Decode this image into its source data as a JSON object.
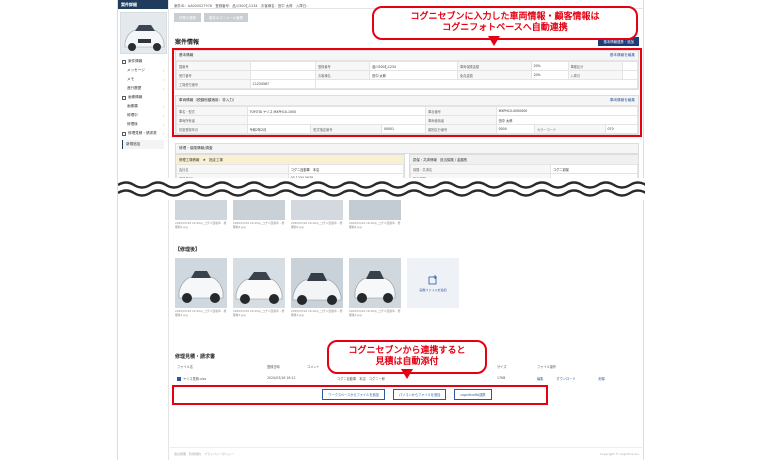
{
  "sidebar": {
    "header": "案件詳細",
    "items": [
      {
        "label": "案件情報",
        "level": 0
      },
      {
        "label": "メッセージ",
        "level": 1
      },
      {
        "label": "メモ",
        "level": 1
      },
      {
        "label": "進行履歴",
        "level": 1
      },
      {
        "label": "画像情報",
        "level": 0
      },
      {
        "label": "画像類",
        "level": 1
      },
      {
        "label": "修理中",
        "level": 1
      },
      {
        "label": "修理後",
        "level": 1
      },
      {
        "label": "修理見積・請求書",
        "level": 0
      }
    ],
    "active_item": "新規追加"
  },
  "topbar": {
    "text": "案件ID：AA000027978　登録番号：品川300む1234　お客様名：田中 太郎　入庫日："
  },
  "buttons": {
    "btn1": "作業の登録",
    "btn2": "基本のコニメール管理",
    "blue": "基本情報連携・追加"
  },
  "case_info": {
    "title": "案件情報",
    "basic": {
      "header": "基本情報",
      "link": "基本情報を編集",
      "rows": [
        [
          "国番号",
          "",
          "登録番号",
          "品川300む1234",
          "車両保険金額",
          "20%",
          "車種区分",
          ""
        ],
        [
          "受付番号",
          "",
          "お客様名",
          "田中 太郎",
          "免責金額",
          "20%",
          "入庫日",
          ""
        ],
        [
          "工場受付番号",
          "C1234567",
          "",
          "",
          "",
          "",
          "",
          ""
        ]
      ]
    },
    "vehicle": {
      "header": "車両情報（税額他額適用：非入力）",
      "link": "車両情報を編集",
      "rows": [
        [
          "車名・型式",
          "TOYOTA ヤリス MXPH10-1000",
          "",
          "",
          "",
          "車台番号",
          "MXPH10-0000000",
          "",
          ""
        ],
        [
          "車両所有者",
          "",
          "",
          "",
          "",
          "車両使用者",
          "田中 太郎",
          "",
          ""
        ],
        [
          "初度登録年月",
          "令和2年2月",
          "型式指定番号",
          "00001",
          "",
          "類別区分番号",
          "0000",
          "カラーコード",
          "070"
        ]
      ]
    }
  },
  "repair_info": {
    "title": "修理・保険情報/調査",
    "left_head": "修理工場情報　★　指定工場",
    "left_rows": [
      [
        "会社名",
        "コグニ自動車　本店"
      ],
      [
        "連絡先TEL",
        "03-1234-5678"
      ],
      [
        "連絡先TEL（FAX）",
        ""
      ]
    ],
    "right_head": "損保・共済情報　該当保険 / 金額別",
    "right_rows": [
      [
        "保険・共済名",
        "コグニ損保"
      ],
      [
        "担当部署",
        ""
      ],
      [
        "連絡先TEL/FAX番号",
        "/"
      ]
    ]
  },
  "photos_before": {
    "captions": [
      "2020/03/16 16:10ip_コグニ自動車 - 修理前1.jpg",
      "2020/03/16 16:10ip_コグニ自動車 - 修理前2.jpg",
      "2020/03/16 16:10ip_コグニ自動車 - 修理前3.jpg",
      "2020/03/16 16:10ip_コグニ自動車 - 修理前4.jpg"
    ]
  },
  "photos_after": {
    "title": "【修理後】",
    "captions": [
      "2020/03/16 16:10ip_コグニ自動車 - 修理後1.jpg",
      "2020/03/16 16:10ip_コグニ自動車 - 修理後2.jpg",
      "2020/03/16 16:10ip_コグニ自動車 - 修理後3.jpg",
      "2020/03/16 16:10ip_コグニ自動車 - 修理後4.jpg"
    ],
    "upload_label": "画像ファイルを追加"
  },
  "estimate": {
    "title": "修理見積・請求書",
    "columns": [
      "ファイル名",
      "登録日時",
      "コメント",
      "作成者",
      "サイズ",
      "ファイル操作"
    ],
    "row": {
      "file": "ヤリス見積.xlsx",
      "date": "2020/03/16 16:12",
      "author": "コグニ自動車　本店　コグニ一郎",
      "size": "17KB",
      "edit": "編集",
      "download": "ダウンロード",
      "delete": "削除"
    },
    "actions": [
      "ワークスペースからファイルを追加",
      "パソコンからファイルを追加",
      "cognitiveRA連携"
    ]
  },
  "callouts": {
    "top": "コグニセブンに入力した車両情報・顧客情報は\nコグニフォトベースへ自動連携",
    "bottom": "コグニセブンから連携すると\n見積は自動添付"
  },
  "footer": {
    "left": "会社概要　利用規約　プライバシーポリシー",
    "right": "Copyright © Cognitive Inc."
  },
  "colors": {
    "callout": "#e60012",
    "accent": "#1f3c7a"
  }
}
